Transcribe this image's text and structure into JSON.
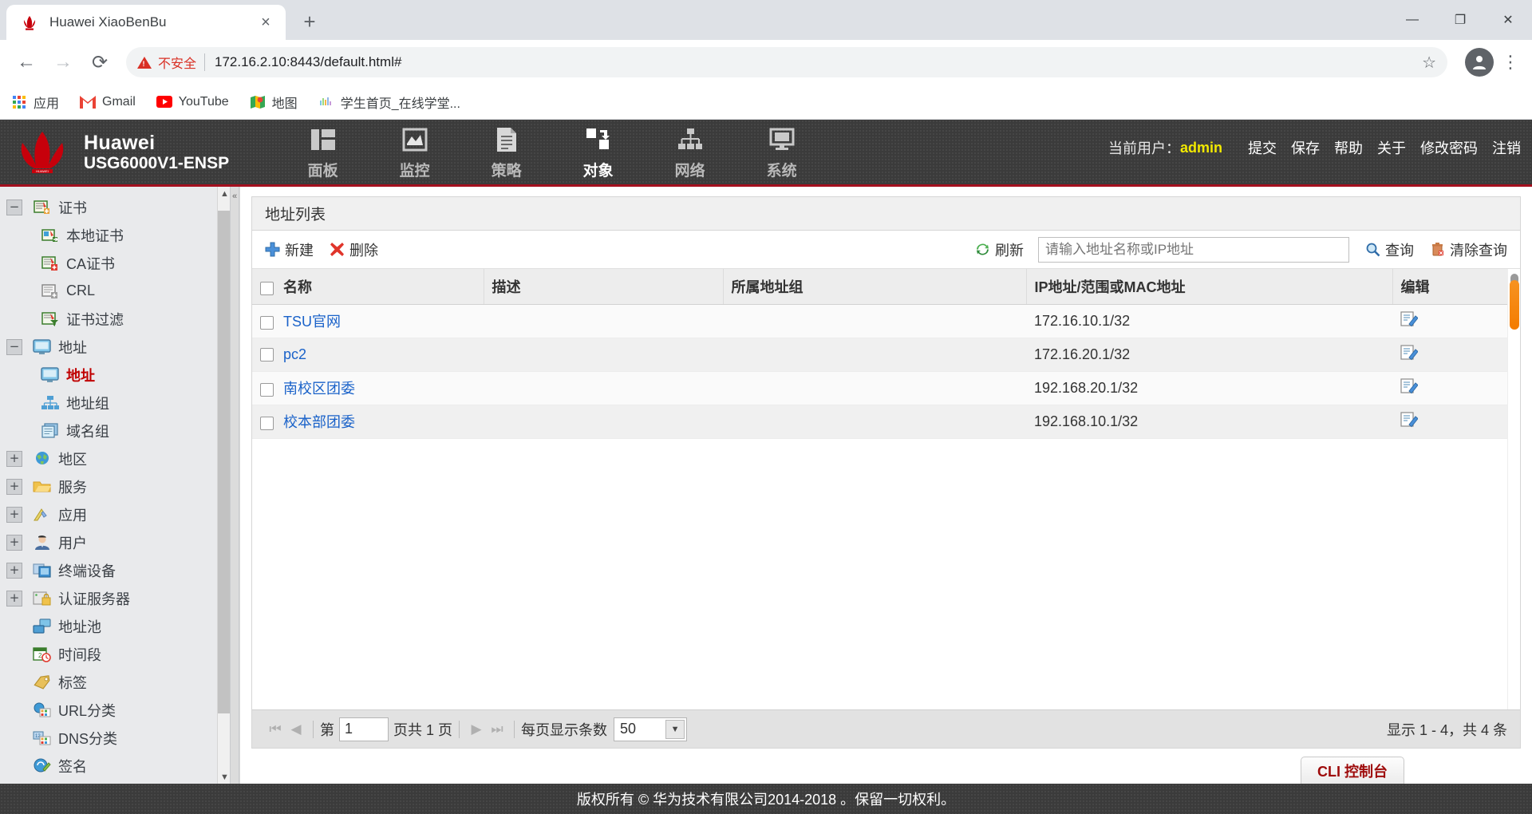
{
  "browser": {
    "tab": {
      "title": "Huawei XiaoBenBu",
      "favicon": "huawei-logo-icon",
      "close": "×"
    },
    "newtab_label": "+",
    "window_controls": {
      "minimize": "—",
      "maximize": "❐",
      "close": "✕"
    },
    "nav": {
      "back": "←",
      "forward": "→",
      "reload": "⟳"
    },
    "omnibox": {
      "security_label": "不安全",
      "url": "172.16.2.10:8443/default.html#",
      "star": "☆"
    },
    "profile": "●",
    "menu": "⋮",
    "bookmarks": [
      {
        "label": "应用",
        "icon": "apps-grid-icon"
      },
      {
        "label": "Gmail",
        "icon": "gmail-icon"
      },
      {
        "label": "YouTube",
        "icon": "youtube-icon"
      },
      {
        "label": "地图",
        "icon": "maps-icon"
      },
      {
        "label": "学生首页_在线学堂...",
        "icon": "generic-site-icon"
      }
    ]
  },
  "app": {
    "brand": {
      "line1": "Huawei",
      "line2": "USG6000V1-ENSP",
      "logo": "huawei-flower-logo"
    },
    "nav": [
      {
        "label": "面板",
        "icon": "dashboard-icon",
        "active": false
      },
      {
        "label": "监控",
        "icon": "monitor-chart-icon",
        "active": false
      },
      {
        "label": "策略",
        "icon": "policy-document-icon",
        "active": false
      },
      {
        "label": "对象",
        "icon": "object-move-icon",
        "active": true
      },
      {
        "label": "网络",
        "icon": "network-tree-icon",
        "active": false
      },
      {
        "label": "系统",
        "icon": "system-display-icon",
        "active": false
      }
    ],
    "userbar": {
      "current_user_label": "当前用户：",
      "username": "admin",
      "username_color": "#f2e900",
      "actions": [
        "提交",
        "保存",
        "帮助",
        "关于",
        "修改密码",
        "注销"
      ]
    },
    "footer": "版权所有 © 华为技术有限公司2014-2018 。保留一切权利。",
    "cli_button": "CLI 控制台"
  },
  "sidebar": {
    "items": [
      {
        "label": "证书",
        "level": 0,
        "toggle": "−",
        "icon": "certificate-icon",
        "selected": false
      },
      {
        "label": "本地证书",
        "level": 1,
        "toggle": "",
        "icon": "local-certificate-icon",
        "selected": false
      },
      {
        "label": "CA证书",
        "level": 1,
        "toggle": "",
        "icon": "ca-certificate-icon",
        "selected": false
      },
      {
        "label": "CRL",
        "level": 1,
        "toggle": "",
        "icon": "crl-icon",
        "selected": false
      },
      {
        "label": "证书过滤",
        "level": 1,
        "toggle": "",
        "icon": "certificate-filter-icon",
        "selected": false
      },
      {
        "label": "地址",
        "level": 0,
        "toggle": "−",
        "icon": "address-monitor-icon",
        "selected": false
      },
      {
        "label": "地址",
        "level": 1,
        "toggle": "",
        "icon": "address-monitor-icon",
        "selected": true
      },
      {
        "label": "地址组",
        "level": 1,
        "toggle": "",
        "icon": "address-group-icon",
        "selected": false
      },
      {
        "label": "域名组",
        "level": 1,
        "toggle": "",
        "icon": "domain-group-icon",
        "selected": false
      },
      {
        "label": "地区",
        "level": 0,
        "toggle": "+",
        "icon": "globe-icon",
        "selected": false
      },
      {
        "label": "服务",
        "level": 0,
        "toggle": "+",
        "icon": "service-folder-icon",
        "selected": false
      },
      {
        "label": "应用",
        "level": 0,
        "toggle": "+",
        "icon": "application-icon",
        "selected": false
      },
      {
        "label": "用户",
        "level": 0,
        "toggle": "+",
        "icon": "user-icon",
        "selected": false
      },
      {
        "label": "终端设备",
        "level": 0,
        "toggle": "+",
        "icon": "terminal-device-icon",
        "selected": false
      },
      {
        "label": "认证服务器",
        "level": 0,
        "toggle": "+",
        "icon": "auth-server-icon",
        "selected": false
      },
      {
        "label": "地址池",
        "level": 0,
        "toggle": "",
        "icon": "address-pool-icon",
        "selected": false
      },
      {
        "label": "时间段",
        "level": 0,
        "toggle": "",
        "icon": "time-range-icon",
        "selected": false
      },
      {
        "label": "标签",
        "level": 0,
        "toggle": "",
        "icon": "tag-icon",
        "selected": false
      },
      {
        "label": "URL分类",
        "level": 0,
        "toggle": "",
        "icon": "url-category-icon",
        "selected": false
      },
      {
        "label": "DNS分类",
        "level": 0,
        "toggle": "",
        "icon": "dns-category-icon",
        "selected": false
      },
      {
        "label": "签名",
        "level": 0,
        "toggle": "",
        "icon": "signature-icon",
        "selected": false
      }
    ],
    "scroll_up": "▲",
    "scroll_down": "▼",
    "collapse": "«"
  },
  "main": {
    "panel_title": "地址列表",
    "toolbar": {
      "new_label": "新建",
      "delete_label": "删除",
      "refresh_label": "刷新",
      "search_placeholder": "请输入地址名称或IP地址",
      "search_value": "",
      "query_label": "查询",
      "clear_label": "清除查询"
    },
    "table": {
      "columns": [
        "名称",
        "描述",
        "所属地址组",
        "IP地址/范围或MAC地址",
        "编辑"
      ],
      "rows": [
        {
          "name": "TSU官网",
          "desc": "",
          "group": "",
          "ip": "172.16.10.1/32",
          "edit": "edit-icon"
        },
        {
          "name": "pc2",
          "desc": "",
          "group": "",
          "ip": "172.16.20.1/32",
          "edit": "edit-icon"
        },
        {
          "name": "南校区团委",
          "desc": "",
          "group": "",
          "ip": "192.168.20.1/32",
          "edit": "edit-icon"
        },
        {
          "name": "校本部团委",
          "desc": "",
          "group": "",
          "ip": "192.168.10.1/32",
          "edit": "edit-icon"
        }
      ]
    },
    "pager": {
      "first": "⏮",
      "prev": "◀",
      "next": "▶",
      "last": "⏭",
      "page_prefix": "第",
      "page_value": "1",
      "page_suffix": "页共 1 页",
      "per_page_label": "每页显示条数",
      "per_page_value": "50",
      "per_page_arrow": "▼",
      "summary": "显示 1 - 4，共 4 条"
    }
  },
  "colors": {
    "huawei_red": "#c7000b",
    "accent_orange": "#f47c00",
    "link_blue": "#1a62c9",
    "selected_red": "#c00000",
    "header_dark": "#3b3b3b"
  }
}
